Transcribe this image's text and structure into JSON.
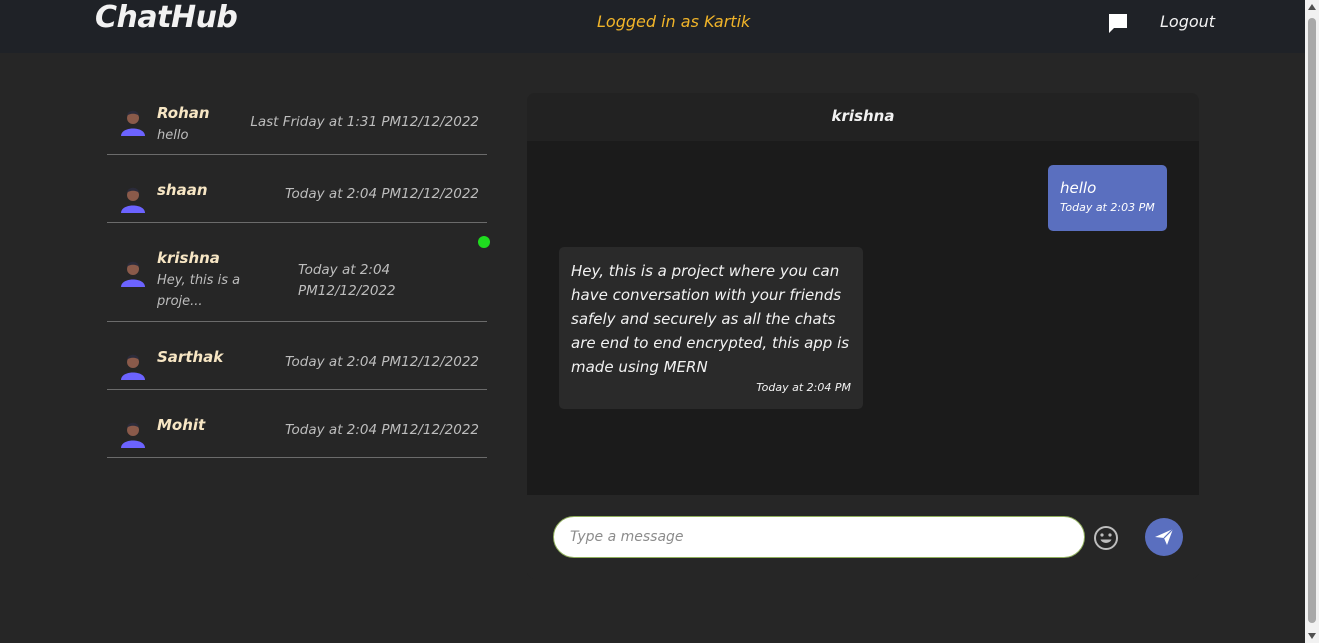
{
  "header": {
    "brand": "ChatHub",
    "logged_in": "Logged in as Kartik",
    "chat_icon": "message-icon",
    "logout": "Logout"
  },
  "contacts": [
    {
      "name": "Rohan",
      "preview": "hello",
      "time": "Last Friday at 1:31 PM12/12/2022",
      "online": false
    },
    {
      "name": "shaan",
      "preview": "",
      "time": "Today at 2:04 PM12/12/2022",
      "online": false
    },
    {
      "name": "krishna",
      "preview": "Hey, this is a proje...",
      "time": "Today at 2:04 PM12/12/2022",
      "online": true
    },
    {
      "name": "Sarthak",
      "preview": "",
      "time": "Today at 2:04 PM12/12/2022",
      "online": false
    },
    {
      "name": "Mohit",
      "preview": "",
      "time": "Today at 2:04 PM12/12/2022",
      "online": false
    }
  ],
  "chat": {
    "title": "krishna",
    "messages": [
      {
        "direction": "outgoing",
        "text": "hello",
        "time": "Today at 2:03 PM"
      },
      {
        "direction": "incoming",
        "text": "Hey, this is a project where you can have conversation with your friends safely and securely as all the chats are end to end encrypted, this app is made using MERN",
        "time": "Today at 2:04 PM"
      }
    ],
    "input_placeholder": "Type a message",
    "input_value": ""
  },
  "colors": {
    "accent": "#5a6fbf",
    "logged_in_text": "#f0b429",
    "online": "#1fdc1f",
    "background": "#262626",
    "topbar": "#1f2227"
  }
}
